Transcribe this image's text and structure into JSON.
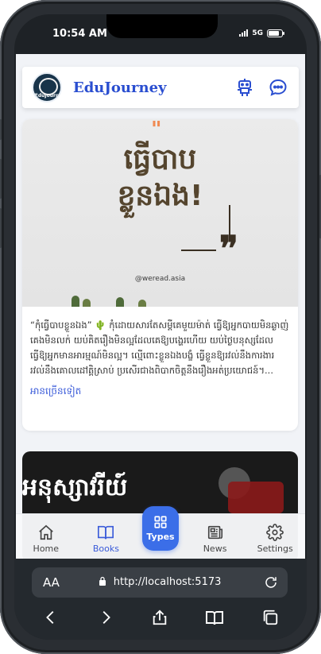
{
  "status": {
    "time": "10:54 AM",
    "network": "5G"
  },
  "header": {
    "brand": "EduJourney",
    "logo_text": "EduJourn"
  },
  "card": {
    "image_title_line1": "ធ្វើបាប",
    "image_title_line2": "ខ្លួនឯង!",
    "image_quote_mark": "\"",
    "image_site": "@weread.asia",
    "text": "“កុំធ្វើបាបខ្លួនឯង” 🌵 កុំដោយសារតែសម្តីគេមួយម៉ាត់ ធ្វើឱ្យអ្នកបាយមិនឆ្ងាញ់ គេងមិនលក់ យប់គិតរឿងមិនល្អដែលគេឱ្យបង្ហេរហើយ យប់ថ្ងៃបនុស្សដែលធ្វើឱ្យអ្នកមានអារម្មណ៍មិនល្អ។ ល្មើពោះខ្លួនឯងបង្ខំ ធ្វើខ្លួនឱ្យរវល់នឹងការងារ រវល់នឹងគោលដៅគ្គិស្រាប់ ប្រសើរជាងពិបាកចិត្តនឹងរឿងអត់ប្រយោជន៍។...",
    "read_more": "អានច្រើនទៀត"
  },
  "card2": {
    "title": "អនុស្សាវរីយ៍"
  },
  "nav": {
    "home": "Home",
    "books": "Books",
    "types": "Types",
    "news": "News",
    "settings": "Settings"
  },
  "browser": {
    "aa": "AA",
    "url": "http://localhost:5173"
  },
  "colors": {
    "brand": "#2a4ed0",
    "accent": "#3b6ee8",
    "link": "#3a5bd9"
  }
}
